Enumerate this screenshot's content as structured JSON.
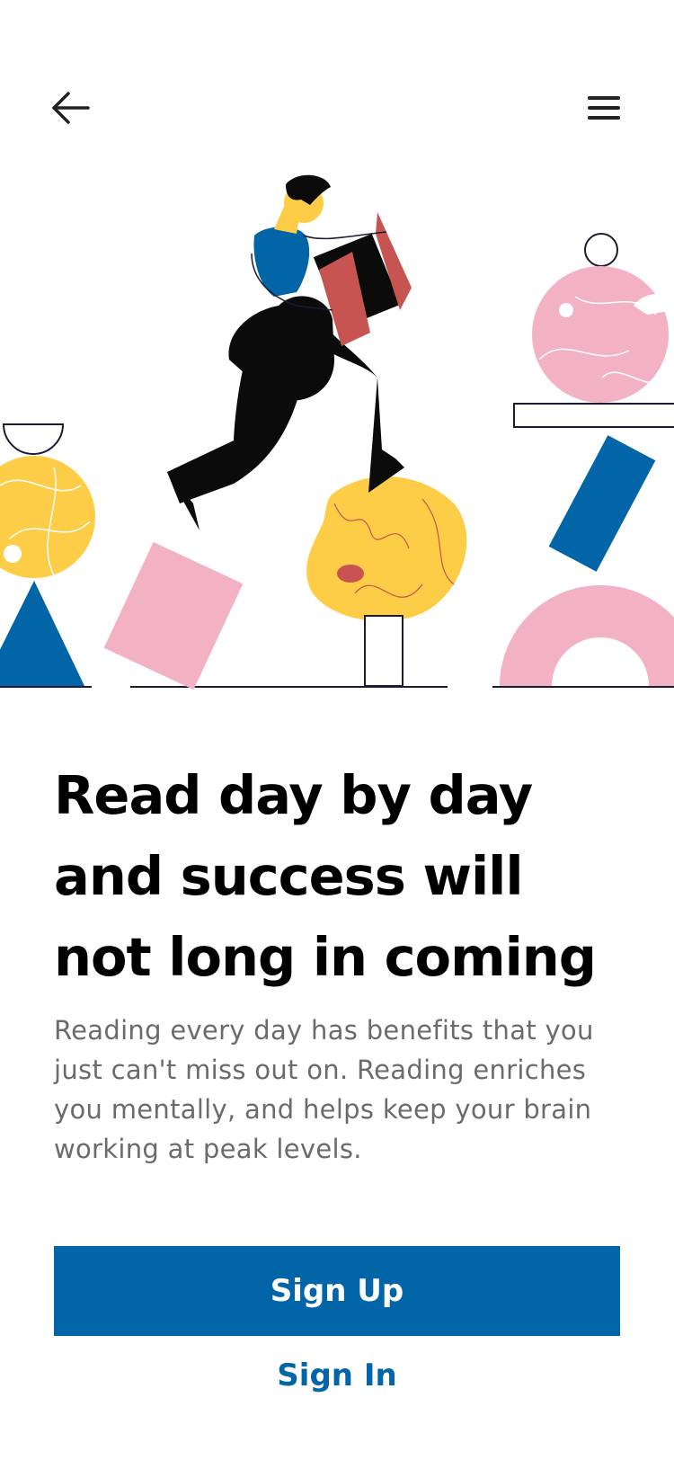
{
  "header": {
    "back_icon": "arrow-left-icon",
    "menu_icon": "hamburger-menu-icon"
  },
  "hero": {
    "illustration": "person-reading-book-on-shapes",
    "colors": {
      "blue": "#0165a8",
      "yellow": "#fdcd47",
      "pink": "#f3b2c4",
      "red": "#c75450",
      "ink": "#0b0b0b"
    }
  },
  "content": {
    "headline": "Read day by day and success will not long in coming",
    "body": "Reading every day has benefits that you just can't miss out on. Reading enriches you mentally, and helps keep your brain working at peak levels."
  },
  "actions": {
    "signup_label": "Sign Up",
    "signin_label": "Sign In"
  }
}
